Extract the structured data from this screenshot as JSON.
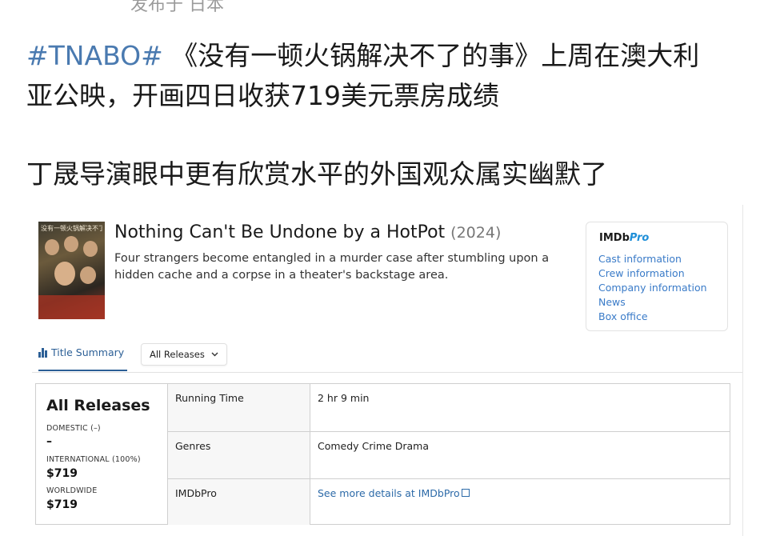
{
  "post": {
    "meta": "发布于 日本",
    "hashtag": "#TNABO#",
    "line1_rest": " 《没有一顿火锅解决不了的事》上周在澳大利",
    "line2": "亚公映，开画四日收获719美元票房成绩",
    "line3": "丁晟导演眼中更有欣赏水平的外国观众属实幽默了"
  },
  "movie": {
    "poster_text": "没有一顿火锅解决不了的事",
    "title": "Nothing Can't Be Undone by a HotPot",
    "year": "(2024)",
    "synopsis": "Four strangers become entangled in a murder case after stumbling upon a hidden cache and a corpse in a theater's backstage area."
  },
  "imdbpro": {
    "logo_main": "IMDb",
    "logo_pro": "Pro",
    "links": [
      "Cast information",
      "Crew information",
      "Company information",
      "News",
      "Box office"
    ]
  },
  "tabs": {
    "summary_label": "Title Summary",
    "dropdown_label": "All Releases"
  },
  "releases": {
    "heading": "All Releases",
    "domestic_label": "DOMESTIC (–)",
    "domestic_value": "–",
    "international_label": "INTERNATIONAL (100%)",
    "international_value": "$719",
    "worldwide_label": "WORLDWIDE",
    "worldwide_value": "$719"
  },
  "details": [
    {
      "key": "Running Time",
      "value": "2 hr 9 min"
    },
    {
      "key": "Genres",
      "value": "Comedy Crime Drama"
    },
    {
      "key": "IMDbPro",
      "value": "See more details at IMDbPro"
    }
  ]
}
